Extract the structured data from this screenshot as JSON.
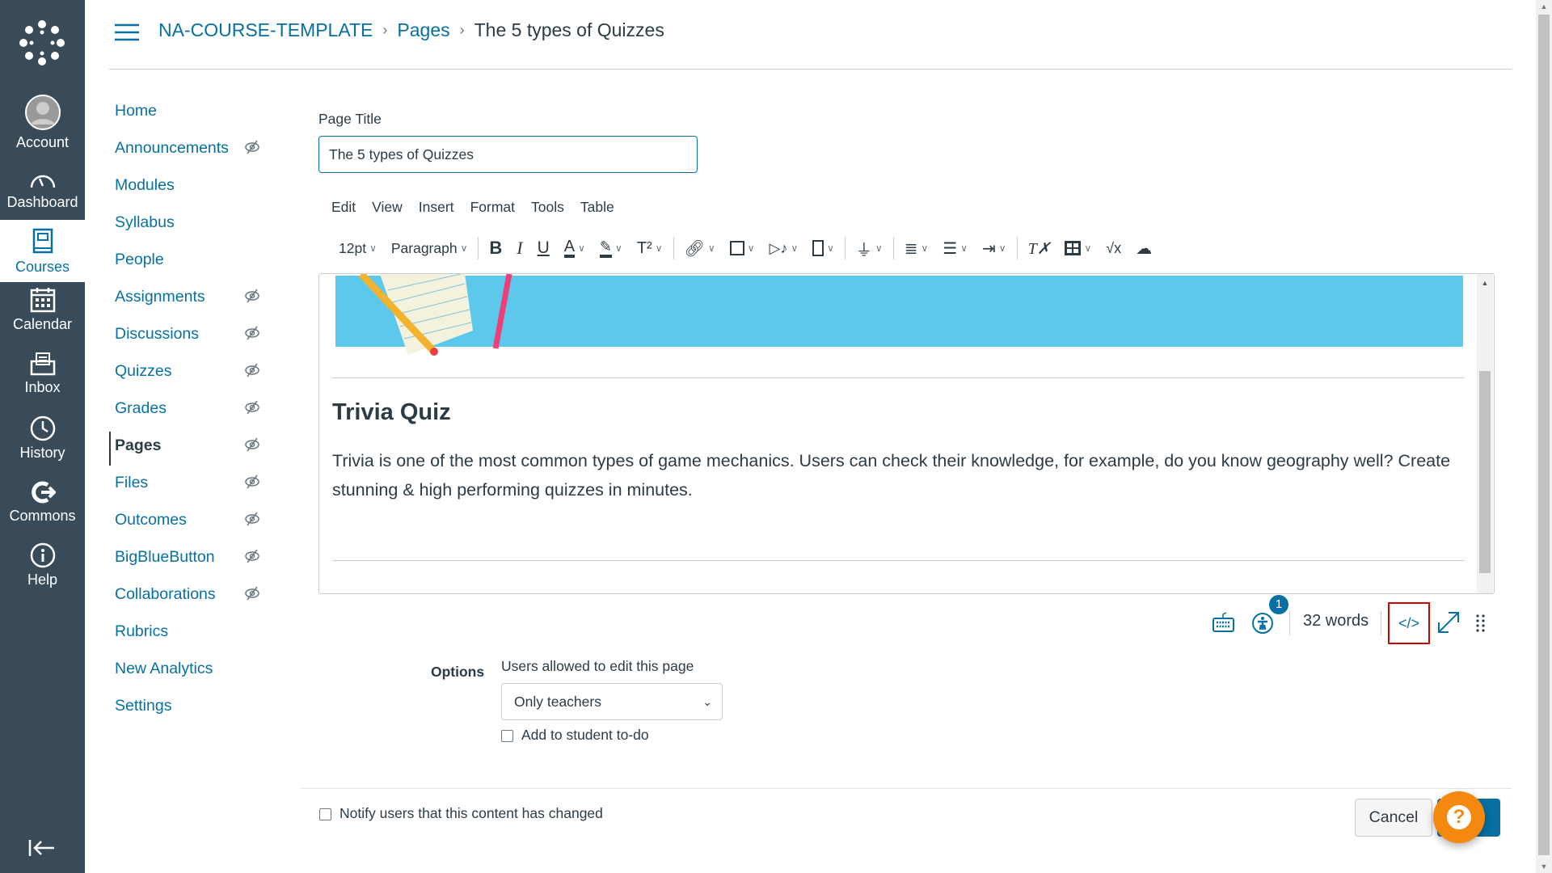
{
  "global_nav": {
    "items": [
      {
        "label": "Account",
        "icon": "avatar-icon"
      },
      {
        "label": "Dashboard",
        "icon": "dashboard-icon"
      },
      {
        "label": "Courses",
        "icon": "courses-icon",
        "active": true
      },
      {
        "label": "Calendar",
        "icon": "calendar-icon"
      },
      {
        "label": "Inbox",
        "icon": "inbox-icon"
      },
      {
        "label": "History",
        "icon": "history-icon"
      },
      {
        "label": "Commons",
        "icon": "commons-icon"
      },
      {
        "label": "Help",
        "icon": "help-icon"
      }
    ]
  },
  "breadcrumb": {
    "course": "NA-COURSE-TEMPLATE",
    "section": "Pages",
    "current": "The 5 types of Quizzes"
  },
  "course_nav": {
    "items": [
      {
        "label": "Home",
        "hidden": false
      },
      {
        "label": "Announcements",
        "hidden": true
      },
      {
        "label": "Modules",
        "hidden": false
      },
      {
        "label": "Syllabus",
        "hidden": false
      },
      {
        "label": "People",
        "hidden": false
      },
      {
        "label": "Assignments",
        "hidden": true
      },
      {
        "label": "Discussions",
        "hidden": true
      },
      {
        "label": "Quizzes",
        "hidden": true
      },
      {
        "label": "Grades",
        "hidden": true
      },
      {
        "label": "Pages",
        "hidden": true,
        "active": true
      },
      {
        "label": "Files",
        "hidden": true
      },
      {
        "label": "Outcomes",
        "hidden": true
      },
      {
        "label": "BigBlueButton",
        "hidden": true
      },
      {
        "label": "Collaborations",
        "hidden": true
      },
      {
        "label": "Rubrics",
        "hidden": false
      },
      {
        "label": "New Analytics",
        "hidden": false
      },
      {
        "label": "Settings",
        "hidden": false
      }
    ]
  },
  "form": {
    "title_label": "Page Title",
    "title_value": "The 5 types of Quizzes"
  },
  "editor": {
    "menu": [
      "Edit",
      "View",
      "Insert",
      "Format",
      "Tools",
      "Table"
    ],
    "font_size": "12pt",
    "block": "Paragraph",
    "heading": "Trivia Quiz",
    "paragraph": "Trivia is one of the most common types of game mechanics. Users can check their knowledge, for example, do you know geography well? Create stunning & high performing quizzes in minutes.",
    "word_count": "32 words",
    "a11y_badge": "1",
    "code_label": "</>"
  },
  "options": {
    "label": "Options",
    "edit_label": "Users allowed to edit this page",
    "edit_value": "Only teachers",
    "todo_label": "Add to student to-do"
  },
  "footer": {
    "notify_label": "Notify users that this content has changed",
    "cancel": "Cancel",
    "help": "?"
  },
  "colors": {
    "nav_bg": "#394b58",
    "link": "#0770a3",
    "banner": "#5bc8ec",
    "help": "#f5890f",
    "highlight_box": "#cc0000"
  }
}
